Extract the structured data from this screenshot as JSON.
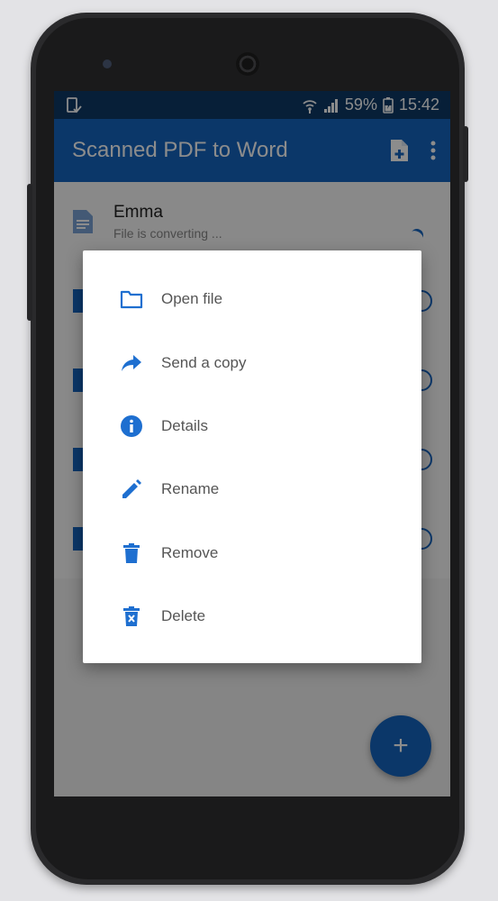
{
  "status_bar": {
    "battery": "59%",
    "time": "15:42"
  },
  "app_bar": {
    "title": "Scanned PDF to Word"
  },
  "file_list": [
    {
      "title": "Emma",
      "subtitle": "File is converting ..."
    }
  ],
  "menu": {
    "items": [
      {
        "label": "Open file",
        "icon": "folder-icon"
      },
      {
        "label": "Send a copy",
        "icon": "share-arrow-icon"
      },
      {
        "label": "Details",
        "icon": "info-icon"
      },
      {
        "label": "Rename",
        "icon": "pencil-icon"
      },
      {
        "label": "Remove",
        "icon": "trash-icon"
      },
      {
        "label": "Delete",
        "icon": "delete-forever-icon"
      }
    ]
  },
  "fab": {
    "label": "+"
  },
  "colors": {
    "primary": "#1565c0",
    "status_bar": "#0d3a66",
    "icon_blue": "#1e6fd0"
  }
}
